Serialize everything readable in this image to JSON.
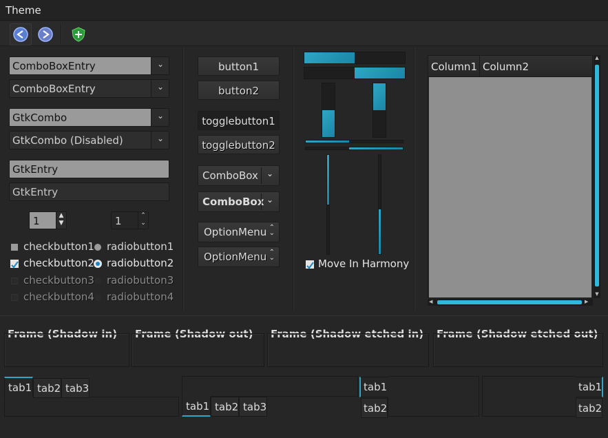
{
  "window": {
    "title": "Theme"
  },
  "toolbar": {
    "buttons": [
      {
        "icon": "back-arrow-icon"
      },
      {
        "icon": "forward-arrow-icon"
      },
      {
        "icon": "shield-icon"
      }
    ]
  },
  "combos": {
    "entry1": "ComboBoxEntry",
    "entry2": "ComboBoxEntry",
    "gtk1": "GtkCombo",
    "gtk2": "GtkCombo (Disabled)",
    "arrow": "⌄"
  },
  "entries": {
    "entry1": "GtkEntry",
    "entry2": "GtkEntry"
  },
  "spins": {
    "spin1": "1",
    "spin2": "1"
  },
  "checks": {
    "cb1": "checkbutton1",
    "cb2": "checkbutton2",
    "cb3": "checkbutton3",
    "cb4": "checkbutton4",
    "rb1": "radiobutton1",
    "rb2": "radiobutton2",
    "rb3": "radiobutton3",
    "rb4": "radiobutton4",
    "harmony": "Move In Harmony"
  },
  "buttons": {
    "b1": "button1",
    "b2": "button2",
    "t1": "togglebutton1",
    "t2": "togglebutton2",
    "cbx1": "ComboBox",
    "cbx2": "ComboBox",
    "om1": "OptionMenu",
    "om2": "OptionMenu"
  },
  "progress": {
    "h1": 0.5,
    "h2": 0.5,
    "v1": 0.5,
    "v2": 0.5
  },
  "scales": {
    "h1": 0.45,
    "h2": 0.55,
    "v1": 0.5,
    "v2": 0.45
  },
  "tree": {
    "columns": [
      "Column1",
      "Column2"
    ]
  },
  "frames": {
    "f1": "Frame (Shadow in)",
    "f2": "Frame (Shadow out)",
    "f3": "Frame (Shadow etched in)",
    "f4": "Frame (Shadow etched out)"
  },
  "tabs": {
    "a": [
      "tab1",
      "tab2",
      "tab3"
    ],
    "b": [
      "tab1",
      "tab2",
      "tab3"
    ],
    "c": [
      "tab1",
      "tab2"
    ],
    "d": [
      "tab1",
      "tab2"
    ]
  },
  "colors": {
    "accent": "#2fa6c6",
    "background": "#262626",
    "active_field": "#9a9a9a"
  }
}
